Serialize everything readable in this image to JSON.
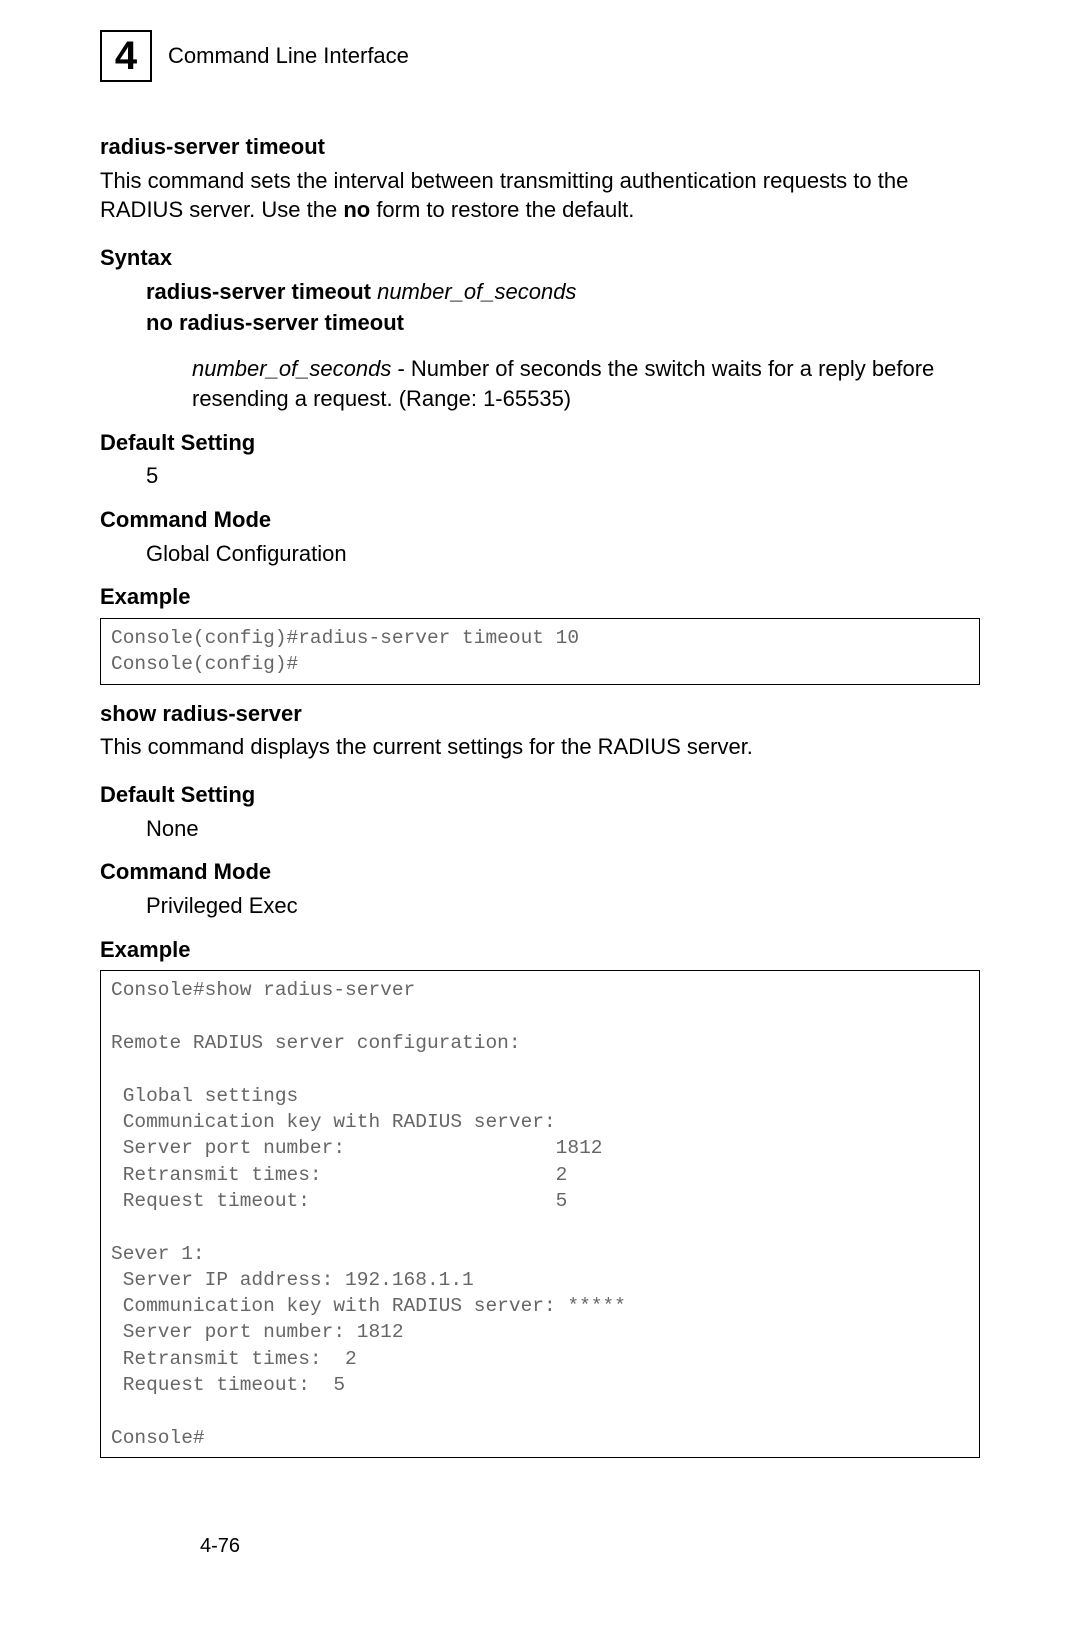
{
  "header": {
    "chapter_number": "4",
    "chapter_title": "Command Line Interface"
  },
  "section1": {
    "title": "radius-server timeout",
    "description_part1": "This command sets the interval between transmitting authentication requests to the RADIUS server. Use the ",
    "description_bold": "no",
    "description_part2": " form to restore the default.",
    "syntax": {
      "label": "Syntax",
      "line1_bold": "radius-server timeout ",
      "line1_italic": "number_of_seconds",
      "line2_bold": "no radius-server timeout",
      "param_italic": "number_of_seconds",
      "param_desc": " - Number of seconds the switch waits for a reply before resending a request. (Range: 1-65535)"
    },
    "default_setting": {
      "label": "Default Setting",
      "value": "5"
    },
    "command_mode": {
      "label": "Command Mode",
      "value": "Global Configuration"
    },
    "example": {
      "label": "Example",
      "code": "Console(config)#radius-server timeout 10\nConsole(config)#"
    }
  },
  "section2": {
    "title": "show radius-server",
    "description": "This command displays the current settings for the RADIUS server.",
    "default_setting": {
      "label": "Default Setting",
      "value": "None"
    },
    "command_mode": {
      "label": "Command Mode",
      "value": "Privileged Exec"
    },
    "example": {
      "label": "Example",
      "code": "Console#show radius-server\n\nRemote RADIUS server configuration:\n\n Global settings\n Communication key with RADIUS server:\n Server port number:                  1812\n Retransmit times:                    2\n Request timeout:                     5\n\nSever 1:\n Server IP address: 192.168.1.1\n Communication key with RADIUS server: *****\n Server port number: 1812\n Retransmit times:  2\n Request timeout:  5\n\nConsole#"
    }
  },
  "footer": {
    "page_number": "4-76"
  }
}
